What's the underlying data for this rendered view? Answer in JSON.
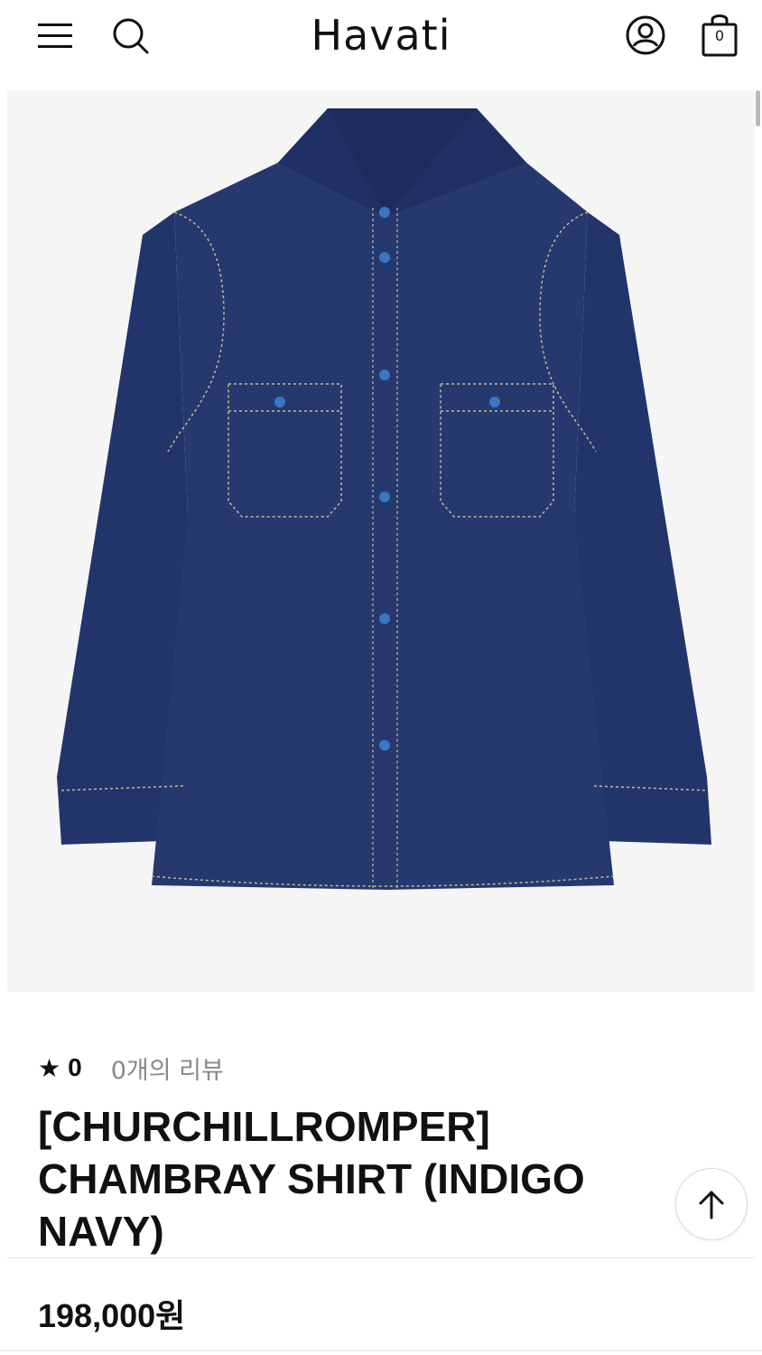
{
  "header": {
    "logo": "Havati",
    "cart_count": "0",
    "icons": [
      "menu-icon",
      "search-icon",
      "account-icon",
      "shopping-bag-icon"
    ]
  },
  "product": {
    "image_description_icon": "denim-shirt-image",
    "rating_star": "★",
    "rating_value": "0",
    "review_count": "0개의 리뷰",
    "title": "[CHURCHILLROMPER] CHAMBRAY SHIRT (INDIGO NAVY)",
    "price": "198,000원"
  },
  "colors": {
    "shirt": "#24386e",
    "stitch": "#c9b78f",
    "image_bg": "#f5f5f5",
    "review_gray": "#888888"
  }
}
